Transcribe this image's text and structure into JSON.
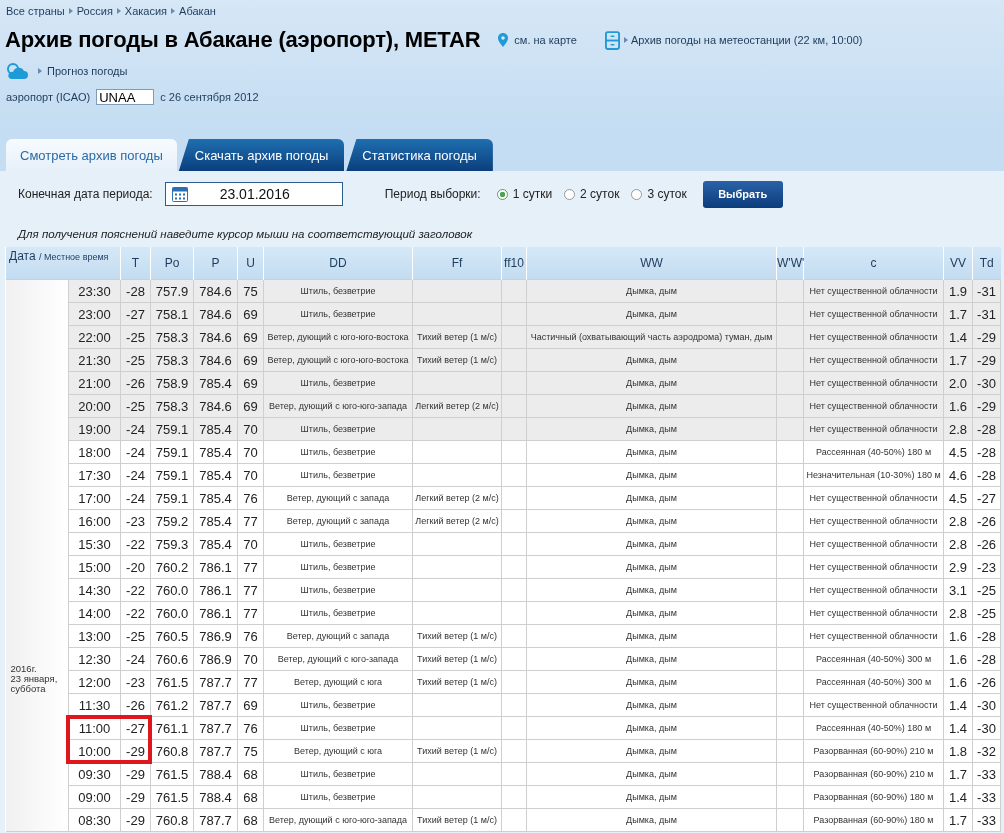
{
  "breadcrumbs": [
    "Все страны",
    "Россия",
    "Хакасия",
    "Абакан"
  ],
  "title": "Архив погоды в Абакане (аэропорт), METAR",
  "map_link": "см. на карте",
  "station_link": "Архив погоды на метеостанции (22 км, 10:00)",
  "forecast_link": "Прогноз погоды",
  "airport": {
    "label": "аэропорт (ICAO)",
    "value": "UNAA",
    "since": "с 26 сентября 2012"
  },
  "tabs": [
    {
      "label": "Смотреть архив погоды",
      "selected": true
    },
    {
      "label": "Скачать архив погоды",
      "selected": false
    },
    {
      "label": "Статистика погоды",
      "selected": false
    }
  ],
  "filter": {
    "end_date_label": "Конечная дата периода:",
    "end_date_value": "23.01.2016",
    "period_label": "Период выборки:",
    "periods": [
      {
        "label": "1 сутки",
        "selected": true
      },
      {
        "label": "2 суток",
        "selected": false
      },
      {
        "label": "3 суток",
        "selected": false
      }
    ],
    "submit": "Выбрать"
  },
  "hint": "Для получения пояснений наведите курсор мыши на соответствующий заголовок",
  "table": {
    "date_header": "Дата",
    "time_header": "/ Местное время",
    "columns": [
      "T",
      "Po",
      "P",
      "U",
      "DD",
      "Ff",
      "ff10",
      "WW",
      "W'W'",
      "c",
      "VV",
      "Td"
    ],
    "date_lines": [
      "2016г.",
      "23 января,",
      "суббота"
    ],
    "rows": [
      {
        "time": "23:30",
        "t": "-28",
        "po": "757.9",
        "p": "784.6",
        "u": "75",
        "dd": "Штиль, безветрие",
        "ww": "Дымка, дым",
        "c": "Нет существенной облачности",
        "vv": "1.9",
        "td": "-31",
        "shaded": true,
        "marked": false
      },
      {
        "time": "23:00",
        "t": "-27",
        "po": "758.1",
        "p": "784.6",
        "u": "69",
        "dd": "Штиль, безветрие",
        "ww": "Дымка, дым",
        "c": "Нет существенной облачности",
        "vv": "1.7",
        "td": "-31",
        "shaded": true,
        "marked": false
      },
      {
        "time": "22:00",
        "t": "-25",
        "po": "758.3",
        "p": "784.6",
        "u": "69",
        "dd": "Ветер, дующий с юго-юго-востока",
        "ff": "Тихий ветер (1 м/с)",
        "ww": "Частичный (охватывающий часть аэродрома) туман, дым",
        "c": "Нет существенной облачности",
        "vv": "1.4",
        "td": "-29",
        "shaded": true,
        "marked": false
      },
      {
        "time": "21:30",
        "t": "-25",
        "po": "758.3",
        "p": "784.6",
        "u": "69",
        "dd": "Ветер, дующий с юго-юго-востока",
        "ff": "Тихий ветер (1 м/с)",
        "ww": "Дымка, дым",
        "c": "Нет существенной облачности",
        "vv": "1.7",
        "td": "-29",
        "shaded": true,
        "marked": false
      },
      {
        "time": "21:00",
        "t": "-26",
        "po": "758.9",
        "p": "785.4",
        "u": "69",
        "dd": "Штиль, безветрие",
        "ww": "Дымка, дым",
        "c": "Нет существенной облачности",
        "vv": "2.0",
        "td": "-30",
        "shaded": true,
        "marked": false
      },
      {
        "time": "20:00",
        "t": "-25",
        "po": "758.3",
        "p": "784.6",
        "u": "69",
        "dd": "Ветер, дующий с юго-юго-запада",
        "ff": "Легкий ветер (2 м/с)",
        "ww": "Дымка, дым",
        "c": "Нет существенной облачности",
        "vv": "1.6",
        "td": "-29",
        "shaded": true,
        "marked": false
      },
      {
        "time": "19:00",
        "t": "-24",
        "po": "759.1",
        "p": "785.4",
        "u": "70",
        "dd": "Штиль, безветрие",
        "ww": "Дымка, дым",
        "c": "Нет существенной облачности",
        "vv": "2.8",
        "td": "-28",
        "shaded": true,
        "marked": false
      },
      {
        "time": "18:00",
        "t": "-24",
        "po": "759.1",
        "p": "785.4",
        "u": "70",
        "dd": "Штиль, безветрие",
        "ww": "Дымка, дым",
        "c": "Рассеянная (40-50%) 180 м",
        "vv": "4.5",
        "td": "-28",
        "shaded": false,
        "marked": false
      },
      {
        "time": "17:30",
        "t": "-24",
        "po": "759.1",
        "p": "785.4",
        "u": "70",
        "dd": "Штиль, безветрие",
        "ww": "Дымка, дым",
        "c": "Незначительная (10-30%) 180 м",
        "vv": "4.6",
        "td": "-28",
        "shaded": false,
        "marked": false
      },
      {
        "time": "17:00",
        "t": "-24",
        "po": "759.1",
        "p": "785.4",
        "u": "76",
        "dd": "Ветер, дующий с запада",
        "ff": "Легкий ветер (2 м/с)",
        "ww": "Дымка, дым",
        "c": "Нет существенной облачности",
        "vv": "4.5",
        "td": "-27",
        "shaded": false,
        "marked": false
      },
      {
        "time": "16:00",
        "t": "-23",
        "po": "759.2",
        "p": "785.4",
        "u": "77",
        "dd": "Ветер, дующий с запада",
        "ff": "Легкий ветер (2 м/с)",
        "ww": "Дымка, дым",
        "c": "Нет существенной облачности",
        "vv": "2.8",
        "td": "-26",
        "shaded": false,
        "marked": false
      },
      {
        "time": "15:30",
        "t": "-22",
        "po": "759.3",
        "p": "785.4",
        "u": "70",
        "dd": "Штиль, безветрие",
        "ww": "Дымка, дым",
        "c": "Нет существенной облачности",
        "vv": "2.8",
        "td": "-26",
        "shaded": false,
        "marked": false
      },
      {
        "time": "15:00",
        "t": "-20",
        "po": "760.2",
        "p": "786.1",
        "u": "77",
        "dd": "Штиль, безветрие",
        "ww": "Дымка, дым",
        "c": "Нет существенной облачности",
        "vv": "2.9",
        "td": "-23",
        "shaded": false,
        "marked": false
      },
      {
        "time": "14:30",
        "t": "-22",
        "po": "760.0",
        "p": "786.1",
        "u": "77",
        "dd": "Штиль, безветрие",
        "ww": "Дымка, дым",
        "c": "Нет существенной облачности",
        "vv": "3.1",
        "td": "-25",
        "shaded": false,
        "marked": false
      },
      {
        "time": "14:00",
        "t": "-22",
        "po": "760.0",
        "p": "786.1",
        "u": "77",
        "dd": "Штиль, безветрие",
        "ww": "Дымка, дым",
        "c": "Нет существенной облачности",
        "vv": "2.8",
        "td": "-25",
        "shaded": false,
        "marked": false
      },
      {
        "time": "13:00",
        "t": "-25",
        "po": "760.5",
        "p": "786.9",
        "u": "76",
        "dd": "Ветер, дующий с запада",
        "ff": "Тихий ветер (1 м/с)",
        "ww": "Дымка, дым",
        "c": "Нет существенной облачности",
        "vv": "1.6",
        "td": "-28",
        "shaded": false,
        "marked": false
      },
      {
        "time": "12:30",
        "t": "-24",
        "po": "760.6",
        "p": "786.9",
        "u": "70",
        "dd": "Ветер, дующий с юго-запада",
        "ff": "Тихий ветер (1 м/с)",
        "ww": "Дымка, дым",
        "c": "Рассеянная (40-50%) 300 м",
        "vv": "1.6",
        "td": "-28",
        "shaded": false,
        "marked": false
      },
      {
        "time": "12:00",
        "t": "-23",
        "po": "761.5",
        "p": "787.7",
        "u": "77",
        "dd": "Ветер, дующий с юга",
        "ff": "Тихий ветер (1 м/с)",
        "ww": "Дымка, дым",
        "c": "Рассеянная (40-50%) 300 м",
        "vv": "1.6",
        "td": "-26",
        "shaded": false,
        "marked": false
      },
      {
        "time": "11:30",
        "t": "-26",
        "po": "761.2",
        "p": "787.7",
        "u": "69",
        "dd": "Штиль, безветрие",
        "ww": "Дымка, дым",
        "c": "Нет существенной облачности",
        "vv": "1.4",
        "td": "-30",
        "shaded": false,
        "marked": false
      },
      {
        "time": "11:00",
        "t": "-27",
        "po": "761.1",
        "p": "787.7",
        "u": "76",
        "dd": "Штиль, безветрие",
        "ww": "Дымка, дым",
        "c": "Рассеянная (40-50%) 180 м",
        "vv": "1.4",
        "td": "-30",
        "shaded": false,
        "marked": true
      },
      {
        "time": "10:00",
        "t": "-29",
        "po": "760.8",
        "p": "787.7",
        "u": "75",
        "dd": "Ветер, дующий с юга",
        "ff": "Тихий ветер (1 м/с)",
        "ww": "Дымка, дым",
        "c": "Разорванная (60-90%) 210 м",
        "vv": "1.8",
        "td": "-32",
        "shaded": false,
        "marked": true
      },
      {
        "time": "09:30",
        "t": "-29",
        "po": "761.5",
        "p": "788.4",
        "u": "68",
        "dd": "Штиль, безветрие",
        "ww": "Дымка, дым",
        "c": "Разорванная (60-90%) 210 м",
        "vv": "1.7",
        "td": "-33",
        "shaded": false,
        "marked": false
      },
      {
        "time": "09:00",
        "t": "-29",
        "po": "761.5",
        "p": "788.4",
        "u": "68",
        "dd": "Штиль, безветрие",
        "ww": "Дымка, дым",
        "c": "Разорванная (60-90%) 180 м",
        "vv": "1.4",
        "td": "-33",
        "shaded": false,
        "marked": false
      },
      {
        "time": "08:30",
        "t": "-29",
        "po": "760.8",
        "p": "787.7",
        "u": "68",
        "dd": "Ветер, дующий с юго-юго-запада",
        "ff": "Тихий ветер (1 м/с)",
        "ww": "Дымка, дым",
        "c": "Разорванная (60-90%) 180 м",
        "vv": "1.7",
        "td": "-33",
        "shaded": false,
        "marked": false
      }
    ]
  }
}
